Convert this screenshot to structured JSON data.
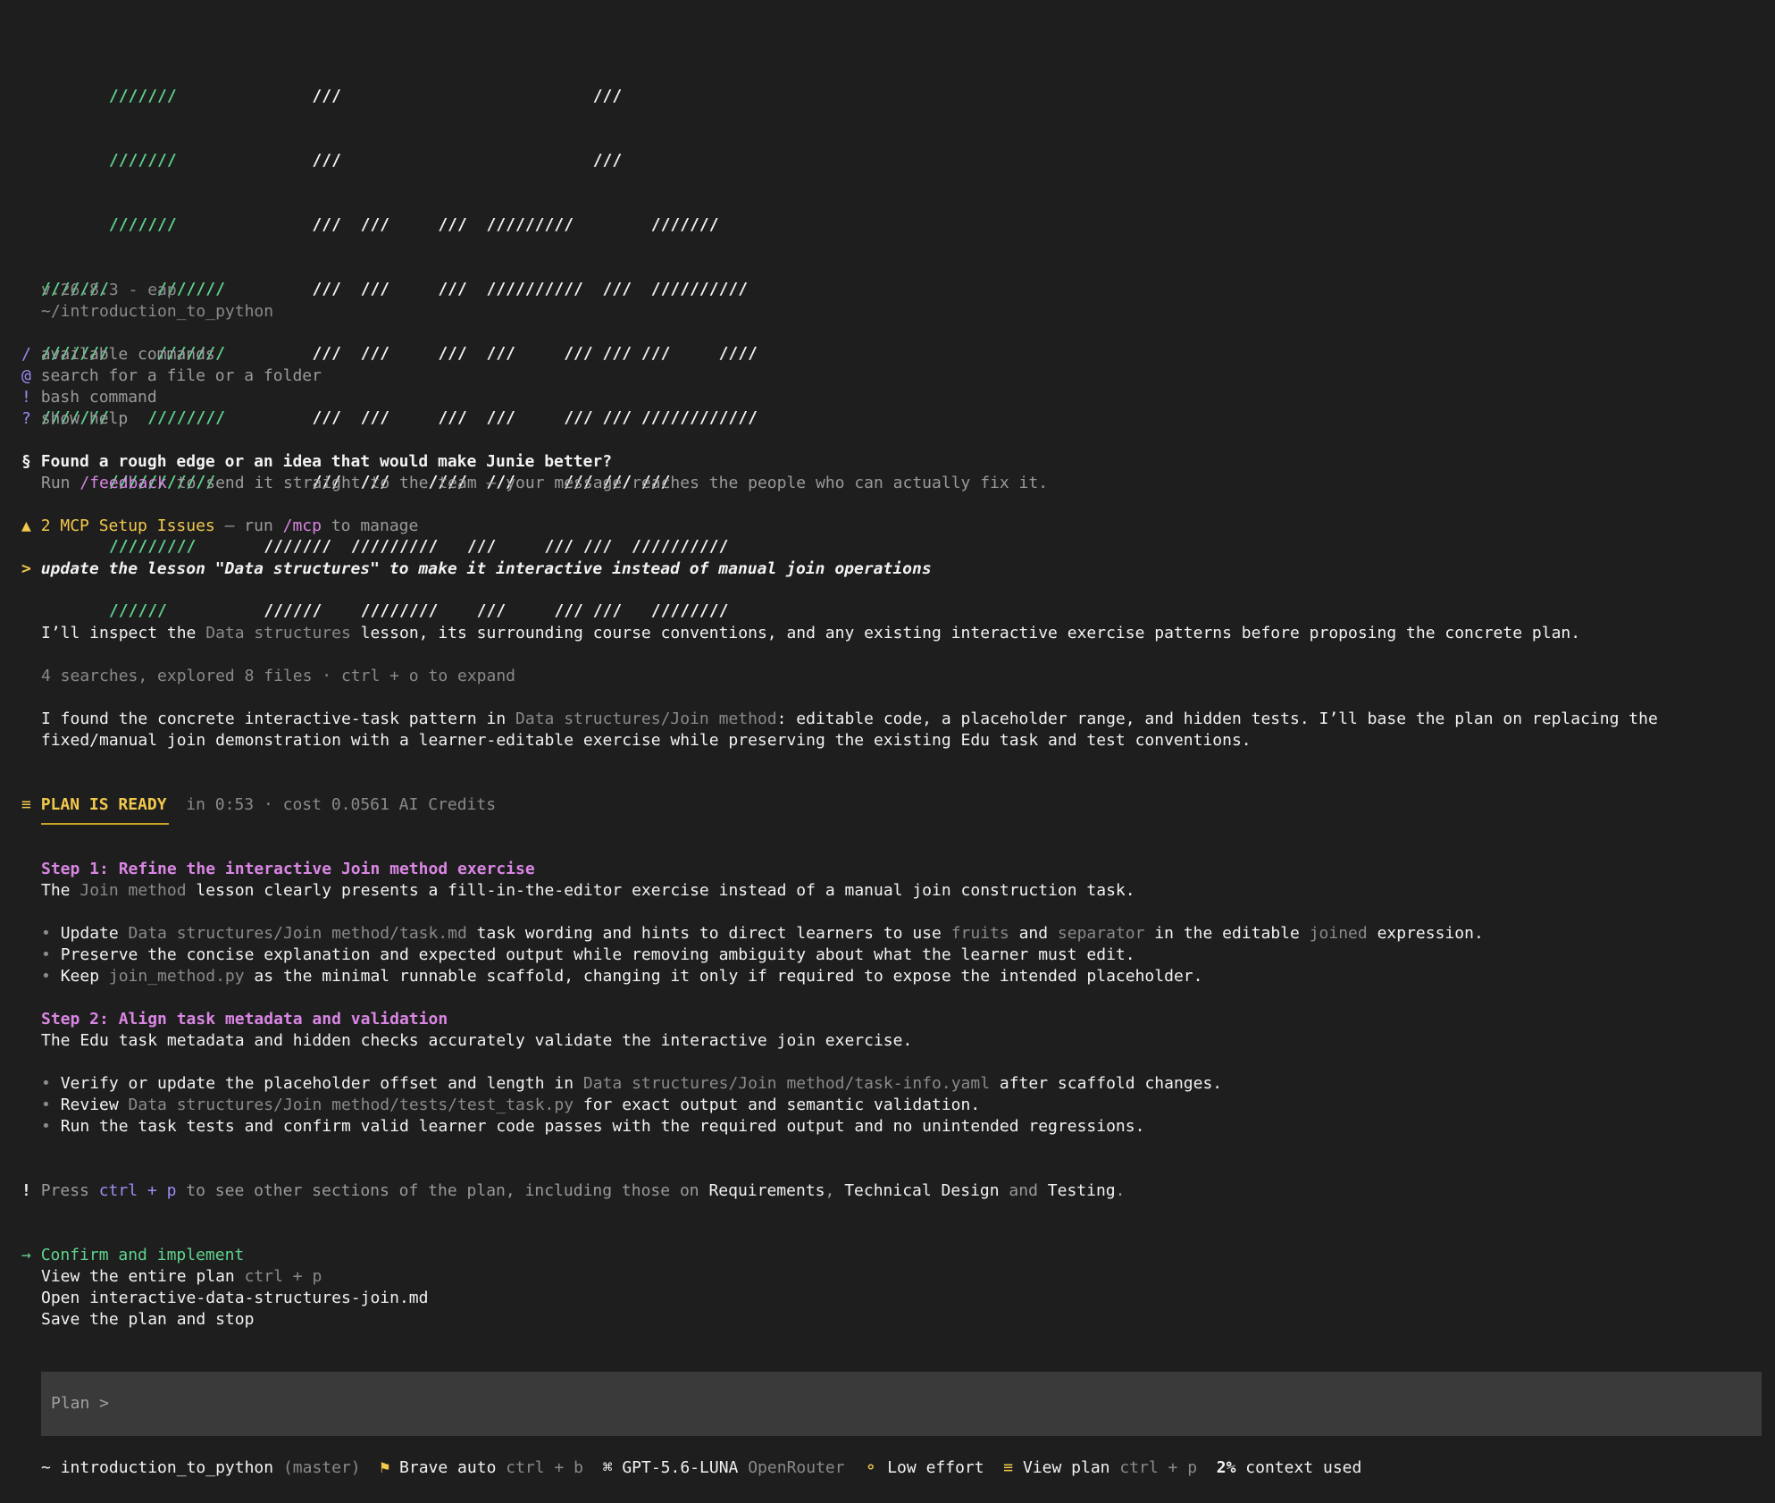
{
  "logo": {
    "lines": [
      {
        "green": "       ///////",
        "white": "              ///                          ///"
      },
      {
        "green": "       ///////",
        "white": "              ///                          ///"
      },
      {
        "green": "       ///////",
        "white": "              ///  ///     ///  /////////        ///////"
      },
      {
        "green": "///////     ///////",
        "white": "         ///  ///     ///  //////////  ///  //////////"
      },
      {
        "green": "///////     ///////",
        "white": "         ///  ///     ///  ///     /// /// ///     ////"
      },
      {
        "green": "///////    ////////",
        "white": "         ///  ///     ///  ///     /// /// ////////////"
      },
      {
        "green": "       ///////////",
        "white": "          ///  ///    ////  ///     /// /// ///"
      },
      {
        "green": "       /////////",
        "white": "       ///////  /////////   ///     /// ///  //////////"
      },
      {
        "green": "       //////",
        "white": "          //////    ////////    ///     /// ///   ////////"
      }
    ]
  },
  "version": "v.26.8.3 - eap",
  "cwd": "~/introduction_to_python",
  "shortcuts": [
    {
      "key": "/",
      "label": "available commands"
    },
    {
      "key": "@",
      "label": "search for a file or a folder"
    },
    {
      "key": "!",
      "label": "bash command"
    },
    {
      "key": "?",
      "label": "show help"
    }
  ],
  "feedback": {
    "symbol": "§",
    "title": "Found a rough edge or an idea that would make Junie better?",
    "pre": "Run ",
    "command": "/feedback",
    "post": " to send it straight to the team — your message reaches the people who can actually fix it."
  },
  "mcp": {
    "symbol": "▲",
    "issue": "2 MCP Setup Issues",
    "pre": " — run ",
    "command": "/mcp",
    "post": " to manage"
  },
  "user_prompt": {
    "symbol": ">",
    "text": "update the lesson \"Data structures\" to make it interactive instead of manual join operations"
  },
  "assistant": {
    "msg1_pre": "I’ll inspect the ",
    "msg1_ref": "Data structures",
    "msg1_post": " lesson, its surrounding course conventions, and any existing interactive exercise patterns before proposing the concrete plan.",
    "activity": "4 searches, explored 8 files · ctrl + o to expand",
    "msg2_pre": "I found the concrete interactive-task pattern in ",
    "msg2_ref": "Data structures/Join method",
    "msg2_post": ": editable code, a placeholder range, and hidden tests. I’ll base the plan on replacing the",
    "msg2_line2": "fixed/manual join demonstration with a learner-editable exercise while preserving the existing Edu task and test conventions."
  },
  "plan_header": {
    "symbol": "≡",
    "title": "PLAN IS READY",
    "meta": "in 0:53 · cost 0.0561 AI Credits"
  },
  "step1": {
    "title": "Step 1: Refine the interactive Join method exercise",
    "desc_pre": "The ",
    "desc_ref": "Join method",
    "desc_post": " lesson clearly presents a fill-in-the-editor exercise instead of a manual join construction task.",
    "b1_pre": "Update ",
    "b1_ref": "Data structures/Join method/task.md",
    "b1_mid": " task wording and hints to direct learners to use ",
    "b1_ref2": "fruits",
    "b1_and": " and ",
    "b1_ref3": "separator",
    "b1_in": " in the editable ",
    "b1_ref4": "joined",
    "b1_post": " expression.",
    "b2": "Preserve the concise explanation and expected output while removing ambiguity about what the learner must edit.",
    "b3_pre": "Keep ",
    "b3_ref": "join_method.py",
    "b3_post": " as the minimal runnable scaffold, changing it only if required to expose the intended placeholder."
  },
  "step2": {
    "title": "Step 2: Align task metadata and validation",
    "desc": "The Edu task metadata and hidden checks accurately validate the interactive join exercise.",
    "b1_pre": "Verify or update the placeholder offset and length in ",
    "b1_ref": "Data structures/Join method/task-info.yaml",
    "b1_post": " after scaffold changes.",
    "b2_pre": "Review ",
    "b2_ref": "Data structures/Join method/tests/test_task.py",
    "b2_post": " for exact output and semantic validation.",
    "b3": "Run the task tests and confirm valid learner code passes with the required output and no unintended regressions."
  },
  "notice": {
    "symbol": "!",
    "pre": "Press ",
    "keys": "ctrl + p",
    "mid": " to see other sections of the plan, including those on ",
    "s1": "Requirements",
    "comma": ", ",
    "s2": "Technical Design",
    "and": " and ",
    "s3": "Testing",
    "end": "."
  },
  "actions": {
    "arrow": "→",
    "confirm": "Confirm and implement",
    "view": "View the entire plan",
    "view_keys": "ctrl + p",
    "open": "Open interactive-data-structures-join.md",
    "save": "Save the plan and stop"
  },
  "input": {
    "prompt": "Plan >"
  },
  "status": {
    "tilde": "~",
    "project": "introduction_to_python",
    "branch": "(master)",
    "mode_icon": "⚑",
    "mode": "Brave auto",
    "mode_keys": "ctrl + b",
    "model_icon": "⌘",
    "model": "GPT-5.6-LUNA",
    "provider": "OpenRouter",
    "effort_icon": "⚬",
    "effort": "Low effort",
    "plan_icon": "≡",
    "plan": "View plan",
    "plan_keys": "ctrl + p",
    "context_pct": "2%",
    "context_label": "context used"
  },
  "colors": {
    "background": "#1e1e1e",
    "accent_green": "#5fd38d",
    "accent_purple": "#9d8cf5",
    "accent_pink": "#d986e3",
    "accent_yellow": "#f2c94c"
  }
}
